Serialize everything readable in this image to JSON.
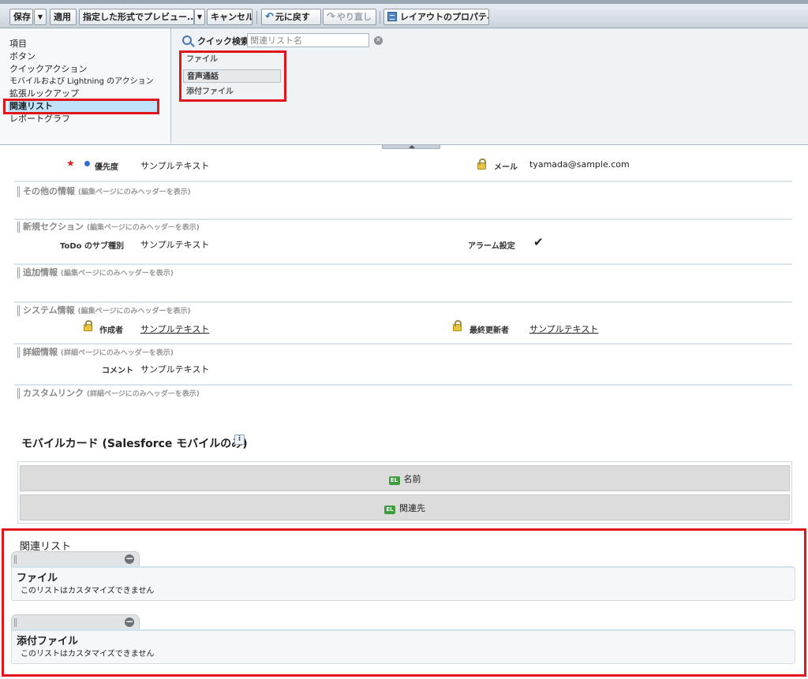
{
  "toolbar": {
    "save": "保存",
    "save_dropdown": "▼",
    "apply": "適用",
    "preview": "指定した形式でプレビュー...",
    "preview_dropdown": "▼",
    "cancel": "キャンセル",
    "undo": "元に戻す",
    "redo": "やり直し",
    "properties": "レイアウトのプロパティ"
  },
  "palette": {
    "categories": [
      "項目",
      "ボタン",
      "クイックアクション",
      "モバイルおよび Lightning のアクション",
      "拡張ルックアップ",
      "関連リスト",
      "レポートグラフ"
    ],
    "selected_category": "関連リスト",
    "quick_find_label": "クイック検索",
    "quick_find_placeholder": "関連リスト名",
    "items": [
      "ファイル",
      "音声通話",
      "添付ファイル"
    ]
  },
  "layout": {
    "priority_label": "優先度",
    "priority_value": "サンプルテキスト",
    "email_label": "メール",
    "email_value": "tyamada@sample.com",
    "section_other": "その他の情報",
    "section_other_note": "(編集ページにのみヘッダーを表示)",
    "section_new": "新規セクション",
    "section_new_note": "(編集ページにのみヘッダーを表示)",
    "todo_subtype_label": "ToDo のサブ種別",
    "todo_subtype_value": "サンプルテキスト",
    "alarm_label": "アラーム設定",
    "alarm_value": "✔",
    "section_additional": "追加情報",
    "section_additional_note": "(編集ページにのみヘッダーを表示)",
    "section_system": "システム情報",
    "section_system_note": "(編集ページにのみヘッダーを表示)",
    "created_by_label": "作成者",
    "created_by_value": "サンプルテキスト",
    "modified_by_label": "最終更新者",
    "modified_by_value": "サンプルテキスト",
    "section_detail": "詳細情報",
    "section_detail_note": "(詳細ページにのみヘッダーを表示)",
    "comment_label": "コメント",
    "comment_value": "サンプルテキスト",
    "section_custom_links": "カスタムリンク",
    "section_custom_links_note": "(詳細ページにのみヘッダーを表示)"
  },
  "mobile_cards": {
    "title": "モバイルカード (Salesforce モバイルのみ)",
    "info_icon": "i",
    "badge": "EL",
    "rows": [
      "名前",
      "関連先"
    ]
  },
  "related_lists": {
    "title": "関連リスト",
    "items": [
      {
        "name": "ファイル",
        "message": "このリストはカスタマイズできません"
      },
      {
        "name": "添付ファイル",
        "message": "このリストはカスタマイズできません"
      }
    ]
  },
  "colors": {
    "highlight_red": "#e0161a",
    "selected_category_bg": "#bfe3fb"
  }
}
